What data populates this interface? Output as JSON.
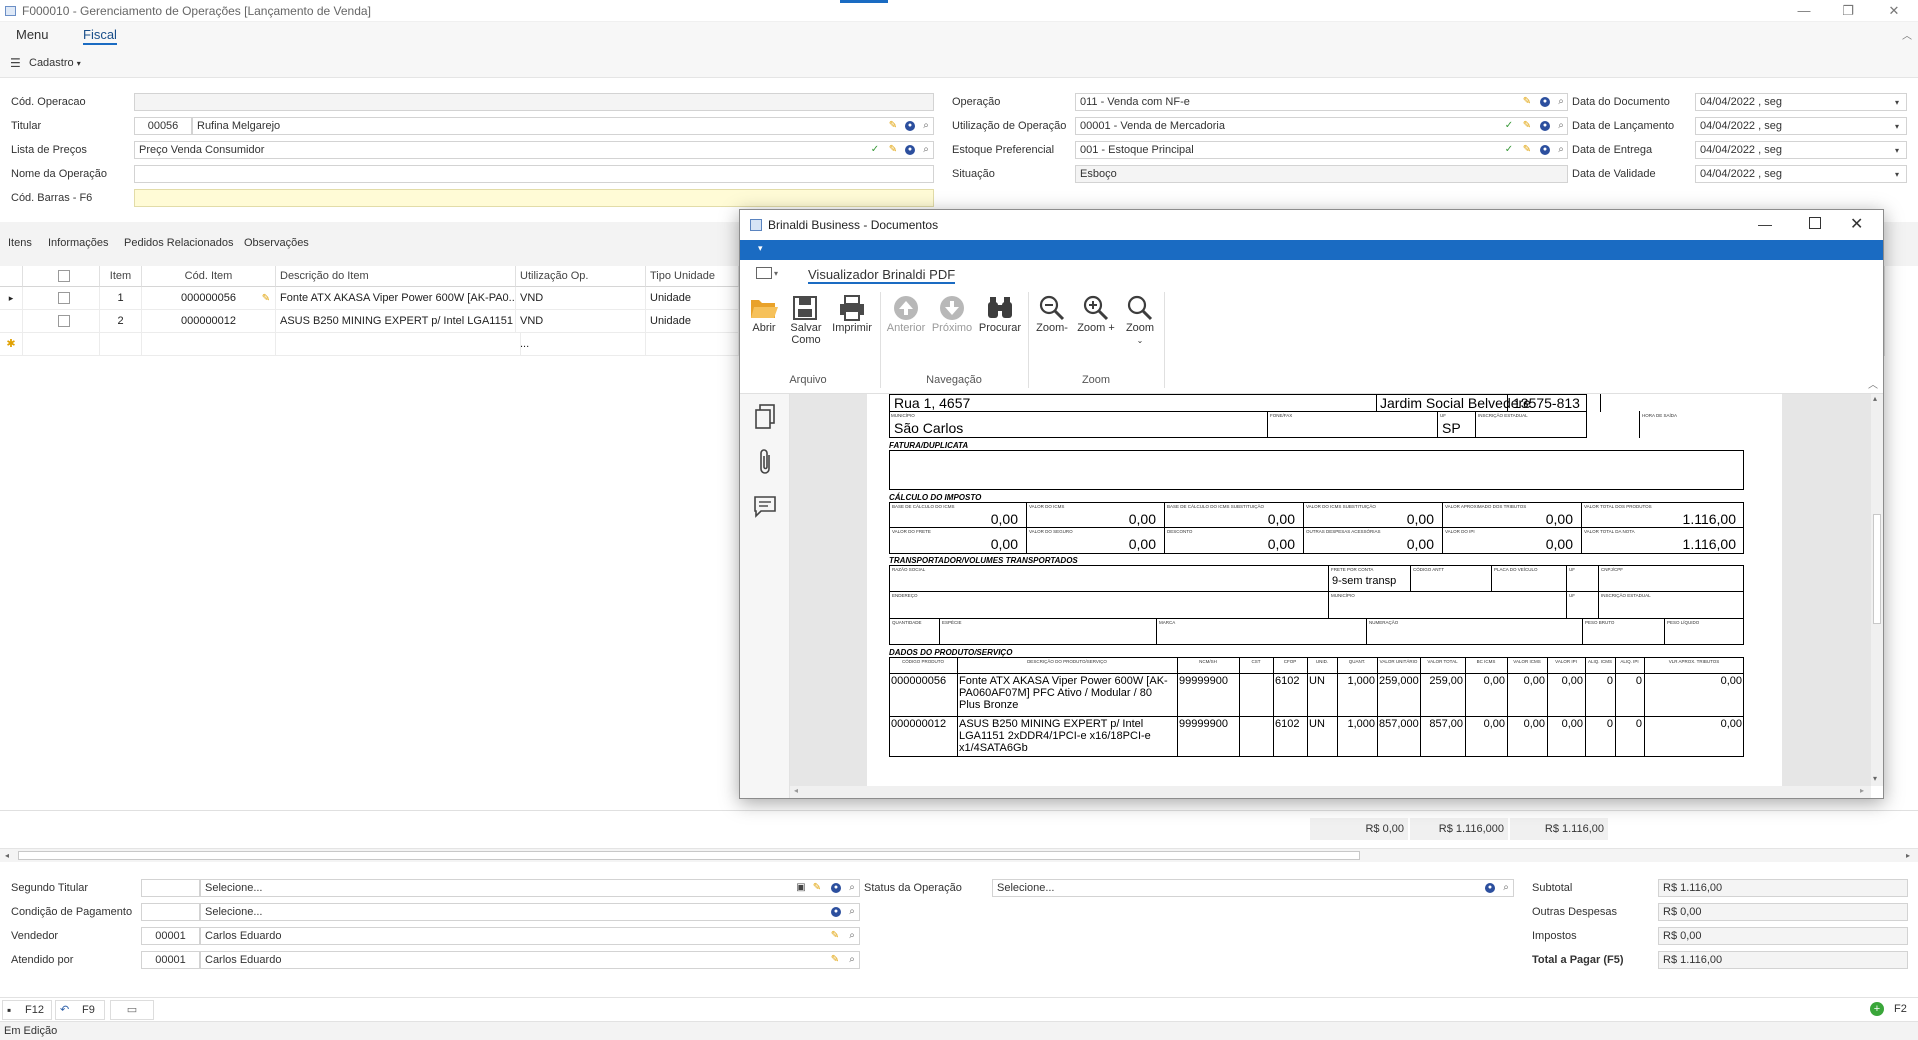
{
  "window": {
    "title": "F000010 - Gerenciamento de Operações [Lançamento de Venda]"
  },
  "ribbon": {
    "tab_menu": "Menu",
    "tab_fiscal": "Fiscal",
    "cadastro": "Cadastro"
  },
  "form": {
    "cod_operacao_label": "Cód. Operacao",
    "titular_label": "Titular",
    "titular_code": "00056",
    "titular_name": "Rufina Melgarejo",
    "lista_precos_label": "Lista de Preços",
    "lista_precos_value": "Preço Venda Consumidor",
    "nome_operacao_label": "Nome da Operação",
    "cod_barras_label": "Cód. Barras - F6",
    "operacao_label": "Operação",
    "operacao_value": "011 - Venda com NF-e",
    "utilizacao_label": "Utilização de Operação",
    "utilizacao_value": "00001 - Venda de Mercadoria",
    "estoque_label": "Estoque Preferencial",
    "estoque_value": "001 - Estoque Principal",
    "situacao_label": "Situação",
    "situacao_value": "Esboço",
    "data_documento_label": "Data do Documento",
    "data_lancamento_label": "Data de Lançamento",
    "data_entrega_label": "Data de Entrega",
    "data_validade_label": "Data de Validade",
    "date_value": "04/04/2022 ,  seg"
  },
  "tabs": [
    "Itens",
    "Informações",
    "Pedidos Relacionados",
    "Observações"
  ],
  "grid": {
    "headers": {
      "item": "Item",
      "cod_item": "Cód. Item",
      "descricao": "Descrição do Item",
      "utilizacao": "Utilização Op.",
      "tipo_unidade": "Tipo Unidade"
    },
    "rows": [
      {
        "item": "1",
        "cod": "000000056",
        "desc": "Fonte ATX AKASA Viper Power 600W [AK-PA0...",
        "util": "VND",
        "tipo": "Unidade"
      },
      {
        "item": "2",
        "cod": "000000012",
        "desc": "ASUS B250 MINING EXPERT p/ Intel LGA1151 ...",
        "util": "VND",
        "tipo": "Unidade"
      }
    ],
    "new_row_placeholder": "...",
    "totals": [
      "R$ 0,00",
      "R$ 1.116,000",
      "R$ 1.116,00"
    ]
  },
  "footer": {
    "segundo_titular_label": "Segundo Titular",
    "select_placeholder": "Selecione...",
    "status_label": "Status da Operação",
    "condicao_label": "Condição de Pagamento",
    "vendedor_label": "Vendedor",
    "vendedor_code": "00001",
    "vendedor_name": "Carlos Eduardo",
    "atendido_label": "Atendido por",
    "atendido_code": "00001",
    "atendido_name": "Carlos Eduardo",
    "subtotal_label": "Subtotal",
    "subtotal_value": "R$ 1.116,00",
    "outras_label": "Outras Despesas",
    "outras_value": "R$ 0,00",
    "impostos_label": "Impostos",
    "impostos_value": "R$ 0,00",
    "total_label": "Total a Pagar (F5)",
    "total_value": "R$ 1.116,00"
  },
  "toolbar": {
    "save_key": "F12",
    "undo_key": "F9",
    "add_key": "F2"
  },
  "status": {
    "text": "Em Edição"
  },
  "dialog": {
    "title": "Brinaldi Business - Documentos",
    "tab": "Visualizador Brinaldi PDF",
    "buttons": {
      "abrir": "Abrir",
      "salvar": "Salvar",
      "salvar2": "Como",
      "imprimir": "Imprimir",
      "anterior": "Anterior",
      "proximo": "Próximo",
      "procurar": "Procurar",
      "zoom_out": "Zoom-",
      "zoom_in": "Zoom +",
      "zoom": "Zoom"
    },
    "groups": {
      "arquivo": "Arquivo",
      "navegacao": "Navegação",
      "zoom": "Zoom"
    }
  },
  "danfe": {
    "address": "Rua 1, 4657",
    "bairro": "Jardim Social Belvedere",
    "cep": "13575-813",
    "municipio_label": "MUNICÍPIO",
    "municipio": "São Carlos",
    "fonefax_label": "FONE/FAX",
    "uf_label": "UF",
    "uf": "SP",
    "ie_label": "INSCRIÇÃO ESTADUAL",
    "hora_label": "HORA DE SAÍDA",
    "fatura_title": "FATURA/DUPLICATA",
    "calculo_title": "CÁLCULO DO IMPOSTO",
    "tax_labels_1": [
      "BASE DE CÁLCULO DO ICMS",
      "VALOR DO ICMS",
      "BASE DE CÁLCULO DO ICMS SUBSTITUIÇÃO",
      "VALOR DO ICMS SUBSTITUIÇÃO",
      "VALOR APROXIMADO DOS TRIBUTOS",
      "VALOR TOTAL DOS PRODUTOS"
    ],
    "tax_values_1": [
      "0,00",
      "0,00",
      "0,00",
      "0,00",
      "0,00",
      "1.116,00"
    ],
    "tax_labels_2": [
      "VALOR DO FRETE",
      "VALOR DO SEGURO",
      "DESCONTO",
      "OUTRAS DESPESAS ACESSÓRIAS",
      "VALOR DO IPI",
      "VALOR TOTAL DA NOTA"
    ],
    "tax_values_2": [
      "0,00",
      "0,00",
      "0,00",
      "0,00",
      "0,00",
      "1.116,00"
    ],
    "transp_title": "TRANSPORTADOR/VOLUMES TRANSPORTADOS",
    "razao_label": "RAZÃO SOCIAL",
    "frete_label": "FRETE POR CONTA",
    "frete_value": "9-sem transp",
    "antt_label": "CÓDIGO ANTT",
    "placa_label": "PLACA DO VEÍCULO",
    "uf2_label": "UF",
    "cnpj_label": "CNPJ/CPF",
    "endereco_label": "ENDEREÇO",
    "municipio2_label": "MUNICÍPIO",
    "uf3_label": "UF",
    "ie2_label": "INSCRIÇÃO ESTADUAL",
    "quant_label": "QUANTIDADE",
    "especie_label": "ESPÉCIE",
    "marca_label": "MARCA",
    "numeracao_label": "NUMERAÇÃO",
    "peso_bruto_label": "PESO BRUTO",
    "peso_liq_label": "PESO LÍQUIDO",
    "produtos_title": "DADOS DO PRODUTO/SERVIÇO",
    "prod_headers": [
      "CÓDIGO PRODUTO",
      "DESCRIÇÃO DO PRODUTO/SERVIÇO",
      "NCM/SH",
      "CST",
      "CFOP",
      "UNID.",
      "QUANT.",
      "VALOR UNITÁRIO",
      "VALOR TOTAL",
      "BC ICMS",
      "VALOR ICMS",
      "VALOR IPI",
      "ALIQ. ICMS",
      "ALIQ. IPI",
      "VLR APROX. TRIBUTOS"
    ],
    "prod_rows": [
      [
        "000000056",
        "Fonte ATX AKASA Viper Power 600W [AK-PA060AF07M] PFC Ativo / Modular / 80 Plus Bronze",
        "99999900",
        "",
        "6102",
        "UN",
        "1,000",
        "259,000",
        "259,00",
        "0,00",
        "0,00",
        "0,00",
        "0",
        "0",
        "0,00"
      ],
      [
        "000000012",
        "ASUS B250 MINING EXPERT p/ Intel LGA1151 2xDDR4/1PCI-e x16/18PCI-e x1/4SATA6Gb",
        "99999900",
        "",
        "6102",
        "UN",
        "1,000",
        "857,000",
        "857,00",
        "0,00",
        "0,00",
        "0,00",
        "0",
        "0",
        "0,00"
      ]
    ]
  }
}
